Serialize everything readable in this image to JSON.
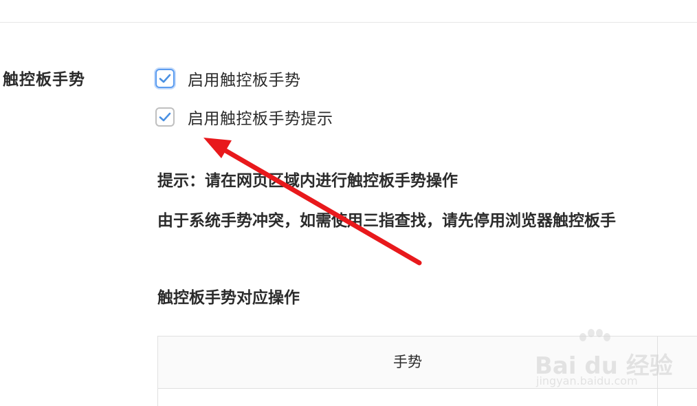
{
  "section": {
    "label": "触控板手势"
  },
  "options": [
    {
      "label": "启用触控板手势",
      "checked": true
    },
    {
      "label": "启用触控板手势提示",
      "checked": true
    }
  ],
  "hint": {
    "title": "提示：请在网页区域内进行触控板手势操作",
    "body": "由于系统手势冲突，如需使用三指查找，请先停用浏览器触控板手"
  },
  "table": {
    "heading": "触控板手势对应操作",
    "columns": [
      "手势"
    ]
  },
  "watermark": {
    "main": "Bai du 经验",
    "sub": "jingyan.baidu.com"
  },
  "colors": {
    "check_blue": "#4a90e2",
    "annotation_arrow": "#e8191c"
  }
}
